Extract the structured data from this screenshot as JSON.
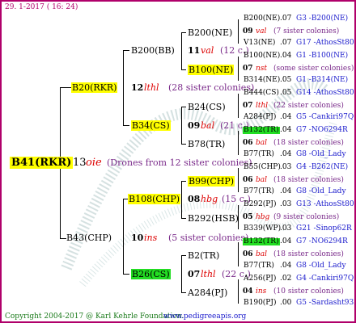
{
  "header": {
    "date": "29.  1-2017 ( 16: 24)"
  },
  "footer": {
    "copyright": "Copyright 2004-2017 @ Karl Kehrle Foundation.",
    "site": "www.pedigreeapis.org"
  },
  "root": {
    "name": "B41(RKR)",
    "num": "13",
    "breeder": "oie",
    "note": "(Drones from 12 sister colonies)"
  },
  "mother": {
    "name": "B20(RKR)",
    "num": "12",
    "breeder": "lthl",
    "note": "(28 sister colonies)"
  },
  "father": {
    "name": "B43(CHP)",
    "num": "10",
    "breeder": "ins",
    "note": "(5 sister colonies)"
  },
  "mm": {
    "name": "B200(BB)",
    "num": "11",
    "breeder": "val",
    "note": "(12 c.)"
  },
  "mf": {
    "name": "B34(CS)",
    "num": "09",
    "breeder": "bal",
    "note": "(21 c.)"
  },
  "fm": {
    "name": "B108(CHP)",
    "num": "08",
    "breeder": "hbg",
    "note": "(15 c.)"
  },
  "ff": {
    "name": "B26(CS)",
    "num": "07",
    "breeder": "lthl",
    "note": "(22 c.)"
  },
  "g3": {
    "a": "B200(NE)",
    "b": "B100(NE)",
    "c": "B24(CS)",
    "d": "B78(TR)",
    "e": "B99(CHP)",
    "f": "B292(HSB)",
    "g": "B2(TR)",
    "h": "A284(PJ)"
  },
  "g4": [
    {
      "n": "B200(NE)",
      "s": ".07",
      "r": "G3 -B200(NE)"
    },
    {
      "num": "09",
      "br": "val",
      "note": "(7 sister colonies)"
    },
    {
      "n": "V13(NE)",
      "s": ".07",
      "r": "G17 -AthosSt80R"
    },
    {
      "n": "B100(NE)",
      "s": ".04",
      "r": "G1 -B100(NE)"
    },
    {
      "num": "07",
      "br": "nst",
      "note": "(some sister colonies)"
    },
    {
      "n": "B314(NE)",
      "s": ".05",
      "r": "G1 -B314(NE)"
    },
    {
      "n": "B444(CS)",
      "s": ".05",
      "r": "G14 -AthosSt80R"
    },
    {
      "num": "07",
      "br": "lthl",
      "note": "(22 sister colonies)"
    },
    {
      "n": "A284(PJ)",
      "s": ".04",
      "r": "G5 -Cankiri97Q"
    },
    {
      "n": "B132(TR)",
      "s": ".04",
      "r": "G7 -NO6294R"
    },
    {
      "num": "06",
      "br": "bal",
      "note": "(18 sister colonies)"
    },
    {
      "n": "B77(TR)",
      "s": ".04",
      "r": "G8 -Old_Lady"
    },
    {
      "n": "B55(CHP)",
      "s": ".03",
      "r": "G4 -B262(NE)"
    },
    {
      "num": "06",
      "br": "bal",
      "note": "(18 sister colonies)"
    },
    {
      "n": "B77(TR)",
      "s": ".04",
      "r": "G8 -Old_Lady"
    },
    {
      "n": "B292(PJ)",
      "s": ".03",
      "r": "G13 -AthosSt80R"
    },
    {
      "num": "05",
      "br": "hbg",
      "note": "(9 sister colonies)"
    },
    {
      "n": "B339(WP)",
      "s": ".03",
      "r": "G21 -Sinop62R"
    },
    {
      "n": "B132(TR)",
      "s": ".04",
      "r": "G7 -NO6294R"
    },
    {
      "num": "06",
      "br": "bal",
      "note": "(18 sister colonies)"
    },
    {
      "n": "B77(TR)",
      "s": ".04",
      "r": "G8 -Old_Lady"
    },
    {
      "n": "A256(PJ)",
      "s": ".02",
      "r": "G4 -Cankiri97Q"
    },
    {
      "num": "04",
      "br": "ins",
      "note": "(10 sister colonies)"
    },
    {
      "n": "B190(PJ)",
      "s": ".00",
      "r": "G5 -Sardasht93R"
    }
  ]
}
